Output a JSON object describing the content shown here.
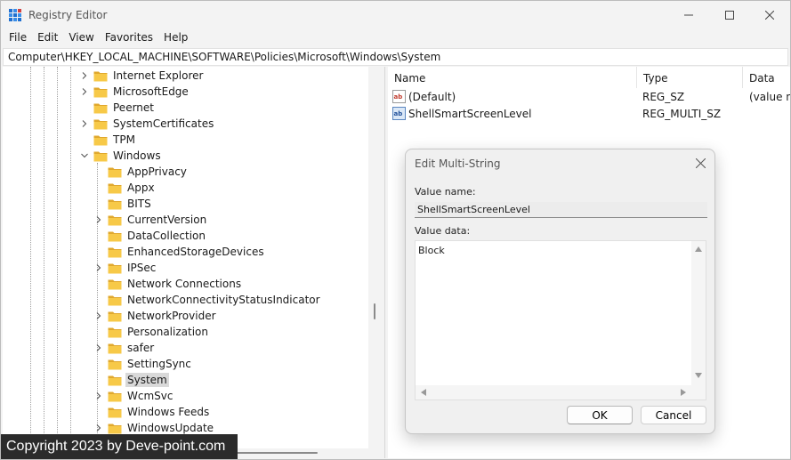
{
  "window": {
    "title": "Registry Editor"
  },
  "menu": [
    "File",
    "Edit",
    "View",
    "Favorites",
    "Help"
  ],
  "address": "Computer\\HKEY_LOCAL_MACHINE\\SOFTWARE\\Policies\\Microsoft\\Windows\\System",
  "tree": {
    "items": [
      {
        "label": "Internet Explorer",
        "level": 1,
        "expander": "collapsed",
        "selected": false
      },
      {
        "label": "MicrosoftEdge",
        "level": 1,
        "expander": "collapsed",
        "selected": false
      },
      {
        "label": "Peernet",
        "level": 1,
        "expander": "none",
        "selected": false
      },
      {
        "label": "SystemCertificates",
        "level": 1,
        "expander": "collapsed",
        "selected": false
      },
      {
        "label": "TPM",
        "level": 1,
        "expander": "none",
        "selected": false
      },
      {
        "label": "Windows",
        "level": 1,
        "expander": "expanded",
        "selected": false
      },
      {
        "label": "AppPrivacy",
        "level": 2,
        "expander": "none",
        "selected": false
      },
      {
        "label": "Appx",
        "level": 2,
        "expander": "none",
        "selected": false
      },
      {
        "label": "BITS",
        "level": 2,
        "expander": "none",
        "selected": false
      },
      {
        "label": "CurrentVersion",
        "level": 2,
        "expander": "collapsed",
        "selected": false
      },
      {
        "label": "DataCollection",
        "level": 2,
        "expander": "none",
        "selected": false
      },
      {
        "label": "EnhancedStorageDevices",
        "level": 2,
        "expander": "none",
        "selected": false
      },
      {
        "label": "IPSec",
        "level": 2,
        "expander": "collapsed",
        "selected": false
      },
      {
        "label": "Network Connections",
        "level": 2,
        "expander": "none",
        "selected": false
      },
      {
        "label": "NetworkConnectivityStatusIndicator",
        "level": 2,
        "expander": "none",
        "selected": false
      },
      {
        "label": "NetworkProvider",
        "level": 2,
        "expander": "collapsed",
        "selected": false
      },
      {
        "label": "Personalization",
        "level": 2,
        "expander": "none",
        "selected": false
      },
      {
        "label": "safer",
        "level": 2,
        "expander": "collapsed",
        "selected": false
      },
      {
        "label": "SettingSync",
        "level": 2,
        "expander": "none",
        "selected": false
      },
      {
        "label": "System",
        "level": 2,
        "expander": "none",
        "selected": true
      },
      {
        "label": "WcmSvc",
        "level": 2,
        "expander": "collapsed",
        "selected": false
      },
      {
        "label": "Windows Feeds",
        "level": 2,
        "expander": "none",
        "selected": false
      },
      {
        "label": "WindowsUpdate",
        "level": 2,
        "expander": "collapsed",
        "selected": false
      }
    ]
  },
  "list": {
    "columns": [
      "Name",
      "Type",
      "Data"
    ],
    "rows": [
      {
        "name": "(Default)",
        "type": "REG_SZ",
        "data": "(value not set)",
        "icon": "string-value-icon"
      },
      {
        "name": "ShellSmartScreenLevel",
        "type": "REG_MULTI_SZ",
        "data": "",
        "icon": "binary-value-icon"
      }
    ]
  },
  "dialog": {
    "title": "Edit Multi-String",
    "value_name_label": "Value name:",
    "value_name": "ShellSmartScreenLevel",
    "value_data_label": "Value data:",
    "value_data": "Block",
    "ok": "OK",
    "cancel": "Cancel"
  },
  "watermark": "Copyright 2023 by Deve-point.com",
  "colors": {
    "folder": "#f7c948",
    "folder_dark": "#e0a82e",
    "selection": "#d9d9d9",
    "accent": "#0067c0"
  }
}
